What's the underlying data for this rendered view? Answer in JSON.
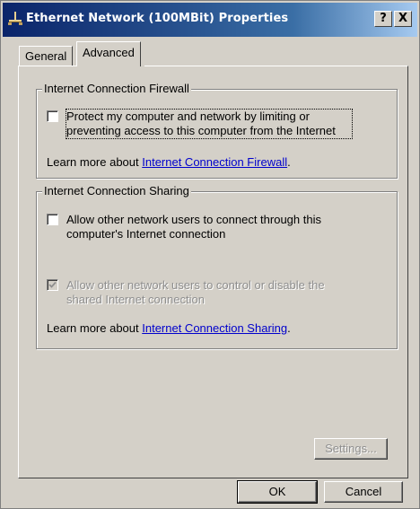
{
  "window": {
    "title": "Ethernet Network (100MBit) Properties",
    "help_button": "?",
    "close_button": "X"
  },
  "tabs": [
    {
      "label": "General",
      "selected": false
    },
    {
      "label": "Advanced",
      "selected": true
    }
  ],
  "firewall": {
    "legend": "Internet Connection Firewall",
    "checkbox_checked": false,
    "checkbox_line1": "Protect my computer and network by limiting or",
    "checkbox_line2": "preventing access to this computer from the Internet",
    "learn_prefix": "Learn more about ",
    "learn_link": "Internet Connection Firewall",
    "learn_suffix": "."
  },
  "sharing": {
    "legend": "Internet Connection Sharing",
    "allow_connect_checked": false,
    "allow_connect_line1": "Allow other network users to connect through this",
    "allow_connect_line2": "computer's Internet connection",
    "allow_control_checked": true,
    "allow_control_disabled": true,
    "allow_control_line1": "Allow other network users to control or disable the",
    "allow_control_line2": "shared Internet connection",
    "learn_prefix": "Learn more about ",
    "learn_link": "Internet Connection Sharing",
    "learn_suffix": "."
  },
  "buttons": {
    "settings": "Settings...",
    "ok": "OK",
    "cancel": "Cancel"
  }
}
